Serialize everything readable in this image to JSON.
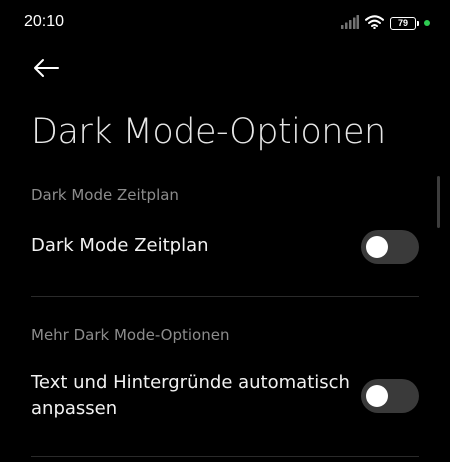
{
  "status_bar": {
    "time": "20:10",
    "battery_level": "79",
    "icons": [
      "signal-icon",
      "wifi-icon",
      "battery-icon",
      "privacy-dot"
    ],
    "colors": {
      "privacy_dot": "#2ecc52"
    }
  },
  "header": {
    "back_icon": "back-arrow-icon",
    "title": "Dark Mode-Optionen"
  },
  "sections": [
    {
      "header": "Dark Mode Zeitplan",
      "items": [
        {
          "label": "Dark Mode Zeitplan",
          "toggle_on": false
        }
      ]
    },
    {
      "header": "Mehr Dark Mode-Optionen",
      "items": [
        {
          "label": "Text und Hintergründe automatisch anpassen",
          "toggle_on": false
        }
      ]
    }
  ]
}
